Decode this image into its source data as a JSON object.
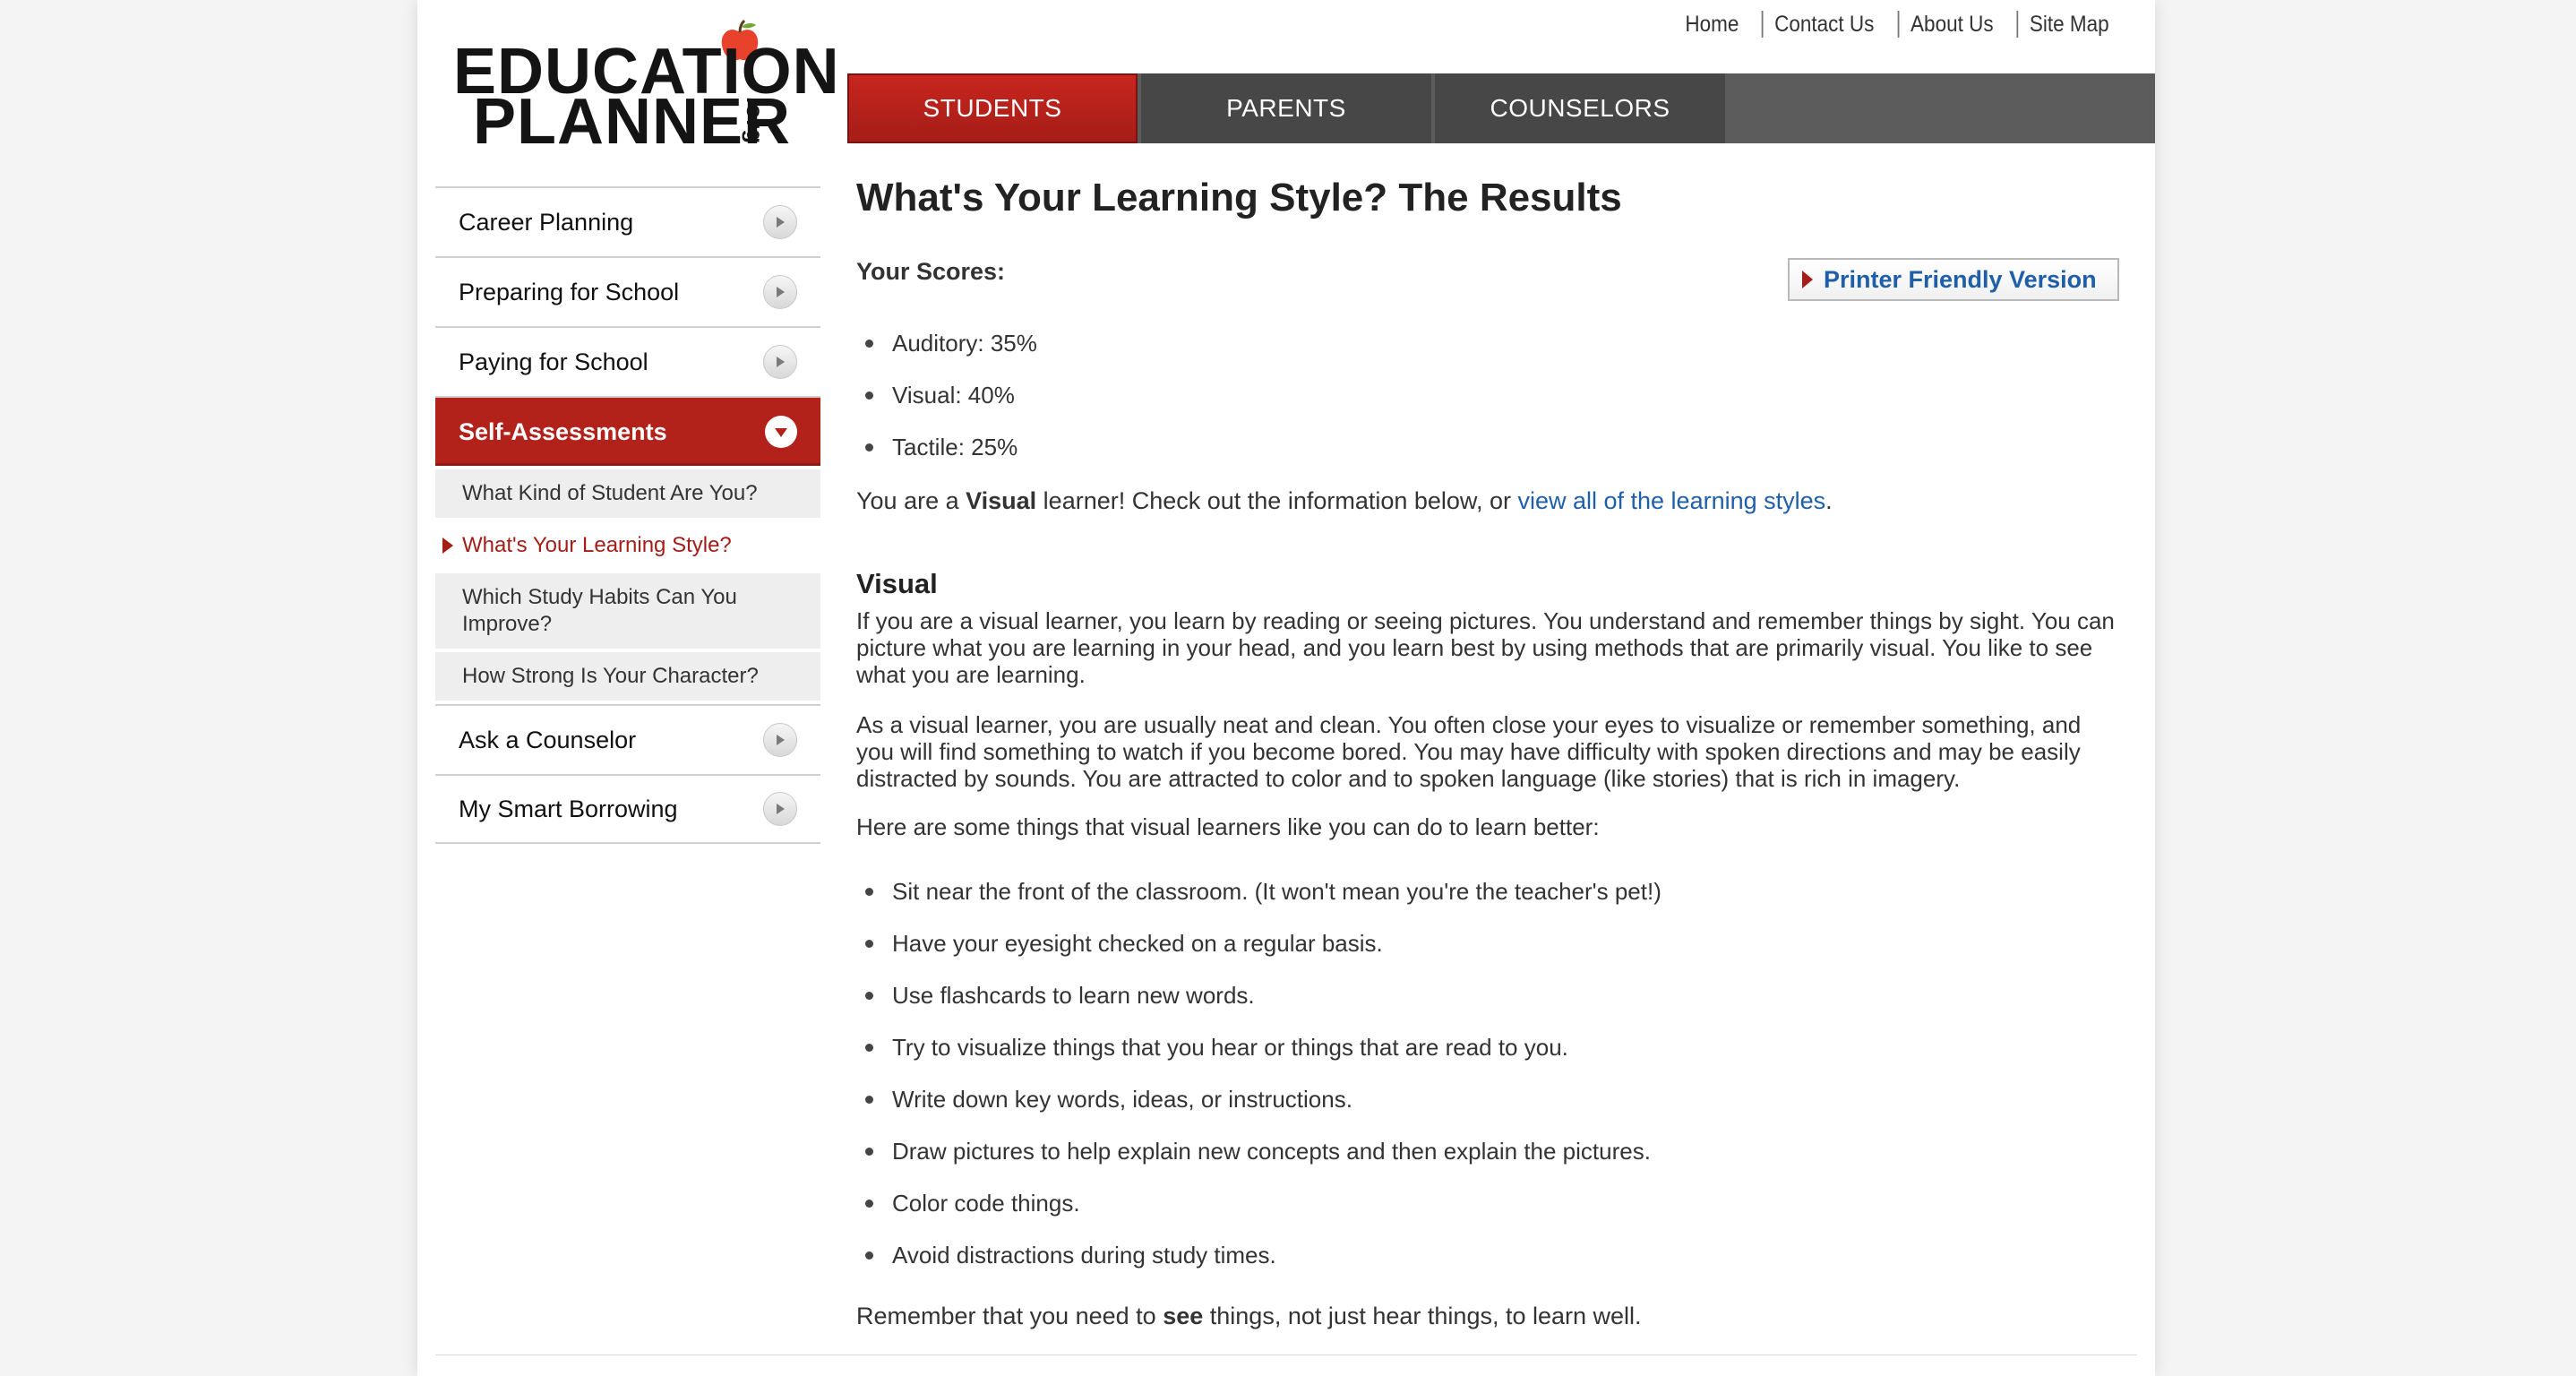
{
  "logo": {
    "line1": "EDUCATION",
    "line2": "PLANNER",
    "suffix": ".org",
    "alt": "Education Planner"
  },
  "util_nav": [
    "Home",
    "Contact Us",
    "About Us",
    "Site Map"
  ],
  "main_nav": {
    "tabs": [
      "STUDENTS",
      "PARENTS",
      "COUNSELORS"
    ],
    "active_tab": "STUDENTS"
  },
  "sidebar": {
    "items": [
      {
        "label": "Career Planning"
      },
      {
        "label": "Preparing for School"
      },
      {
        "label": "Paying for School"
      },
      {
        "label": "Self-Assessments"
      },
      {
        "label": "Ask a Counselor"
      },
      {
        "label": "My Smart Borrowing"
      }
    ],
    "sub_items": [
      {
        "label": "What Kind of Student Are You?"
      },
      {
        "label": "What's Your Learning Style?"
      },
      {
        "label": "Which Study Habits Can You Improve?"
      },
      {
        "label": "How Strong Is Your Character?"
      }
    ]
  },
  "content": {
    "title": "What's Your Learning Style? The Results",
    "scores_label": "Your Scores:",
    "printer_button": "Printer Friendly Version",
    "scores": [
      "Auditory: 35%",
      "Visual: 40%",
      "Tactile: 25%"
    ],
    "result": {
      "prefix": "You are a ",
      "style": "Visual",
      "middle": " learner! Check out the information below, or ",
      "link": "view all of the learning styles",
      "suffix": "."
    },
    "section_heading": "Visual",
    "para1": "If you are a visual learner, you learn by reading or seeing pictures. You understand and remember things by sight. You can picture what you are learning in your head, and you learn best by using methods that are primarily visual. You like to see what you are learning.",
    "para2": "As a visual learner, you are usually neat and clean. You often close your eyes to visualize or remember something, and you will find something to watch if you become bored. You may have difficulty with spoken directions and may be easily distracted by sounds. You are attracted to color and to spoken language (like stories) that is rich in imagery.",
    "para3": "Here are some things that visual learners like you can do to learn better:",
    "tips": [
      "Sit near the front of the classroom. (It won't mean you're the teacher's pet!)",
      "Have your eyesight checked on a regular basis.",
      "Use flashcards to learn new words.",
      "Try to visualize things that you hear or things that are read to you.",
      "Write down key words, ideas, or instructions.",
      "Draw pictures to help explain new concepts and then explain the pictures.",
      "Color code things.",
      "Avoid distractions during study times."
    ],
    "closing": {
      "prefix": "Remember that you need to ",
      "bold": "see",
      "suffix": " things, not just hear things, to learn well."
    }
  },
  "colors": {
    "accent_red": "#b3211b",
    "nav_dark": "#474747",
    "link_blue": "#1f5ea8",
    "text": "#333333"
  }
}
